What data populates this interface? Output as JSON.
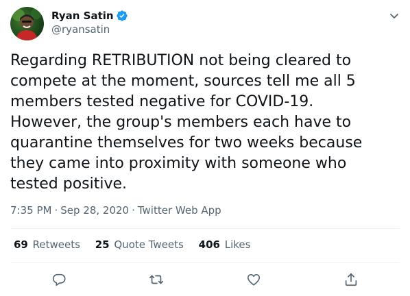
{
  "author": {
    "name": "Ryan Satin",
    "handle": "@ryansatin",
    "verified": true
  },
  "tweet": {
    "text": "Regarding RETRIBUTION not being cleared to\ncompete at the moment, sources tell me all 5\nmembers tested negative for COVID-19.\nHowever, the group's members each have to\nquarantine themselves for two weeks because\nthey came into proximity with someone who\ntested positive.",
    "time": "7:35 PM",
    "date": "Sep 28, 2020",
    "source": "Twitter Web App",
    "separator": "·"
  },
  "stats": {
    "retweets": {
      "count": "69",
      "label": "Retweets"
    },
    "quote_tweets": {
      "count": "25",
      "label": "Quote Tweets"
    },
    "likes": {
      "count": "406",
      "label": "Likes"
    }
  },
  "icons": {
    "verified": "verified-badge-icon",
    "more": "chevron-down-icon",
    "reply": "reply-icon",
    "retweet": "retweet-icon",
    "like": "heart-icon",
    "share": "share-icon"
  },
  "colors": {
    "verified": "#1d9bf0",
    "secondary_text": "#536471",
    "divider": "#eff3f4"
  }
}
